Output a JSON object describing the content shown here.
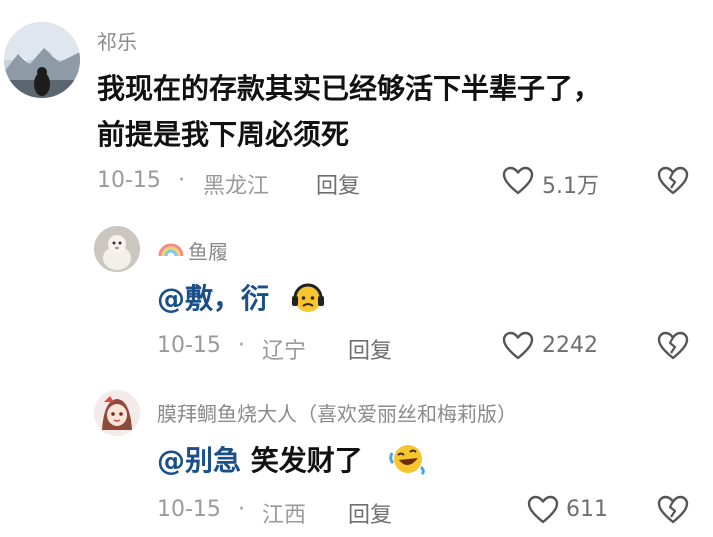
{
  "comments": [
    {
      "username": "祁乐",
      "content": [
        "我现在的存款其实已经够活下半辈子了，",
        "前提是我下周必须死"
      ],
      "date": "10-15",
      "dot": "·",
      "location": "黑龙江",
      "reply_label": "回复",
      "likes": "5.1万",
      "avatar_icon": "snow-mountain-avatar"
    },
    {
      "username": "鱼履",
      "name_icon": "rainbow-icon",
      "mention": "@敷，衍",
      "emoji": "headphone-face-emoji",
      "date": "10-15",
      "dot": "·",
      "location": "辽宁",
      "reply_label": "回复",
      "likes": "2242",
      "avatar_icon": "pet-avatar"
    },
    {
      "username": "膜拜鲷鱼烧大人（喜欢爱丽丝和梅莉版）",
      "mention": "@别急",
      "text": "笑发财了",
      "emoji": "laugh-cry-emoji",
      "date": "10-15",
      "dot": "·",
      "location": "江西",
      "reply_label": "回复",
      "likes": "611",
      "avatar_icon": "anime-girl-avatar"
    }
  ]
}
